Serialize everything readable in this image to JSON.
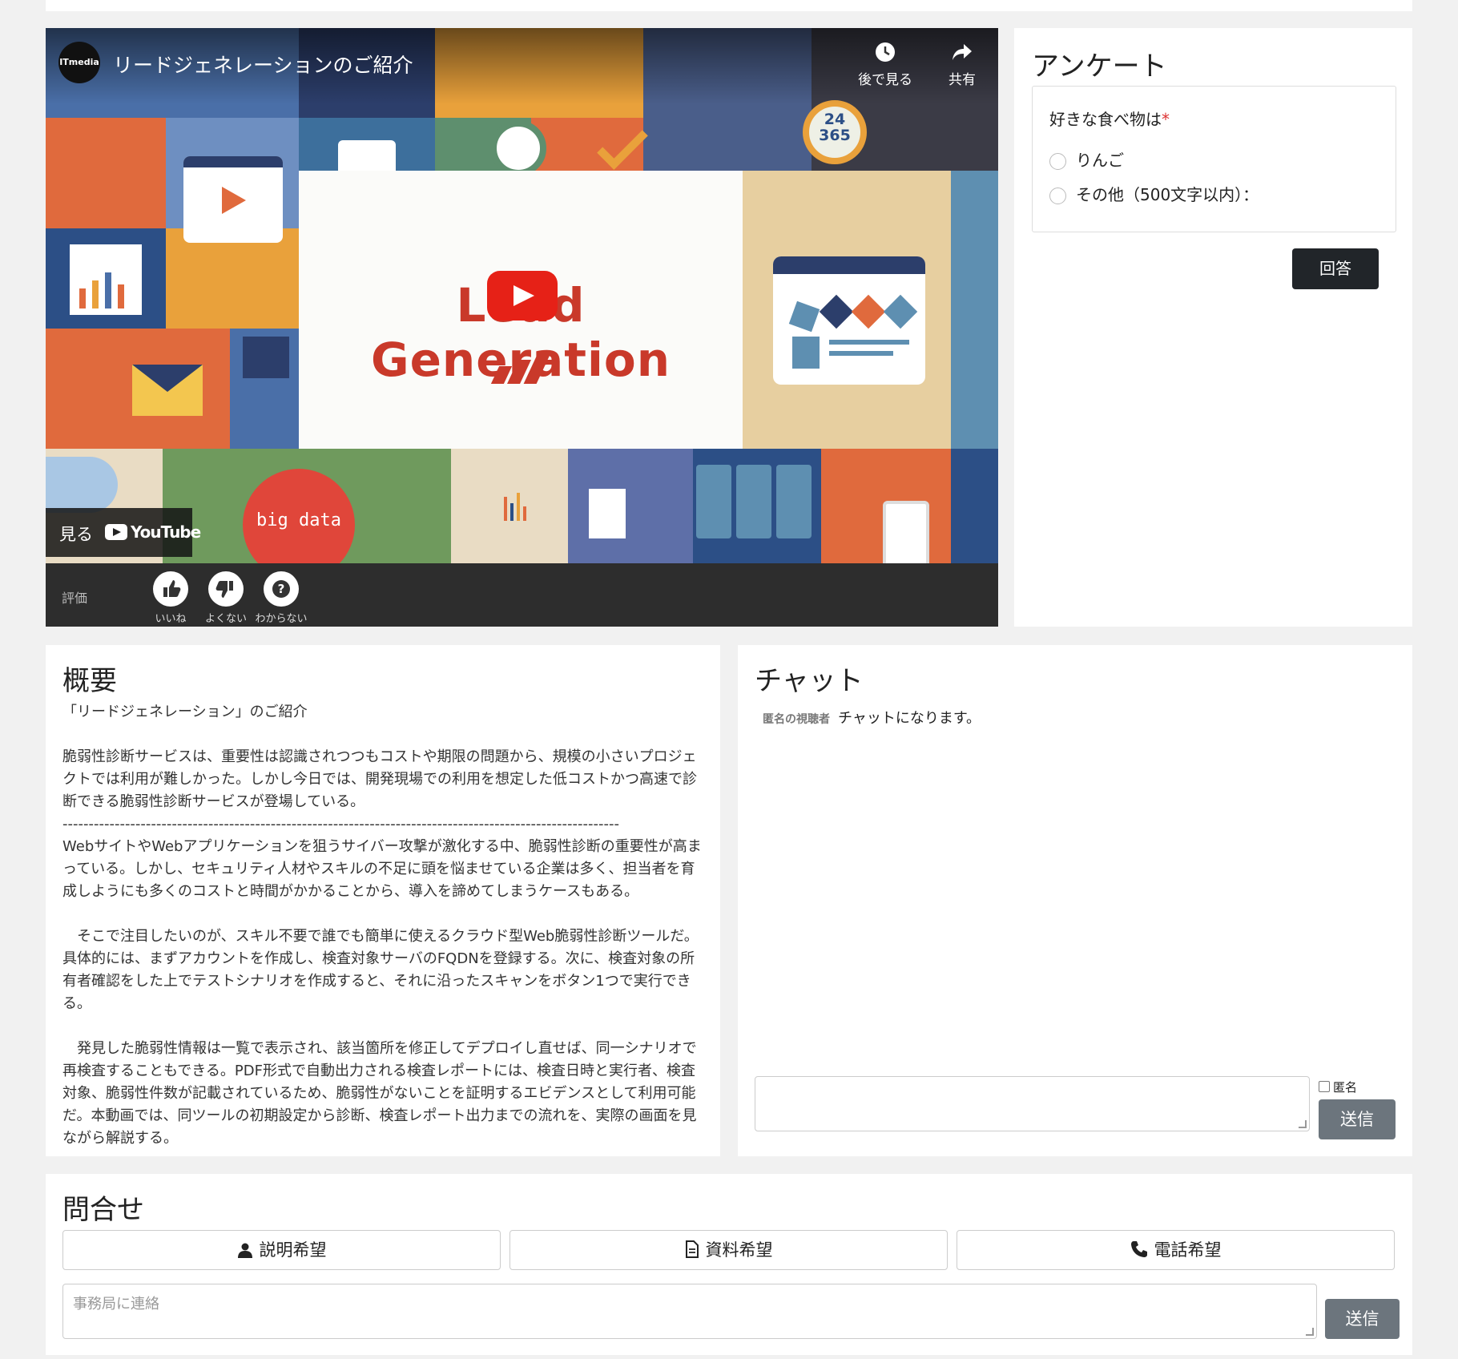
{
  "video": {
    "channel_logo": "ITmedia",
    "title": "リードジェネレーションのご紹介",
    "watch_later": "後で見る",
    "share": "共有",
    "lead_text": "Lead Generation",
    "watch_on": "見る",
    "youtube": "YouTube",
    "big_data": "big data",
    "clock_text": "24\n365",
    "rating_label": "評価",
    "ratings": [
      "いいね",
      "よくない",
      "わからない"
    ]
  },
  "survey": {
    "title": "アンケート",
    "question": "好きな食べ物は",
    "required_mark": "*",
    "options": [
      "りんご",
      "その他（500文字以内）："
    ],
    "answer_button": "回答"
  },
  "overview": {
    "title": "概要",
    "body": "「リードジェネレーション」のご紹介\n\n脆弱性診断サービスは、重要性は認識されつつもコストや期限の問題から、規模の小さいプロジェクトでは利用が難しかった。しかし今日では、開発現場での利用を想定した低コストかつ高速で診断できる脆弱性診断サービスが登場している。\n-----------------------------------------------------------------------------------------------------------\nWebサイトやWebアプリケーションを狙うサイバー攻撃が激化する中、脆弱性診断の重要性が高まっている。しかし、セキュリティ人材やスキルの不足に頭を悩ませている企業は多く、担当者を育成しようにも多くのコストと時間がかかることから、導入を諦めてしまうケースもある。\n\n　そこで注目したいのが、スキル不要で誰でも簡単に使えるクラウド型Web脆弱性診断ツールだ。具体的には、まずアカウントを作成し、検査対象サーバのFQDNを登録する。次に、検査対象の所有者確認をした上でテストシナリオを作成すると、それに沿ったスキャンをボタン1つで実行できる。\n\n　発見した脆弱性情報は一覧で表示され、該当箇所を修正してデプロイし直せば、同一シナリオで再検査することもできる。PDF形式で自動出力される検査レポートには、検査日時と実行者、検査対象、脆弱性件数が記載されているため、脆弱性がないことを証明するエビデンスとして利用可能だ。本動画では、同ツールの初期設定から診断、検査レポート出力までの流れを、実際の画面を見ながら解説する。"
  },
  "chat": {
    "title": "チャット",
    "messages": [
      {
        "user": "匿名の視聴者",
        "text": "チャットになります。"
      }
    ],
    "anonymous_label": "匿名",
    "send_button": "送信"
  },
  "inquiry": {
    "title": "問合せ",
    "buttons": [
      "説明希望",
      "資料希望",
      "電話希望"
    ],
    "placeholder": "事務局に連絡",
    "send_button": "送信"
  },
  "colors": {
    "accent_dark": "#212529",
    "button_gray": "#6c757d",
    "play_red": "#e62117",
    "lead_red": "#c9392a"
  }
}
